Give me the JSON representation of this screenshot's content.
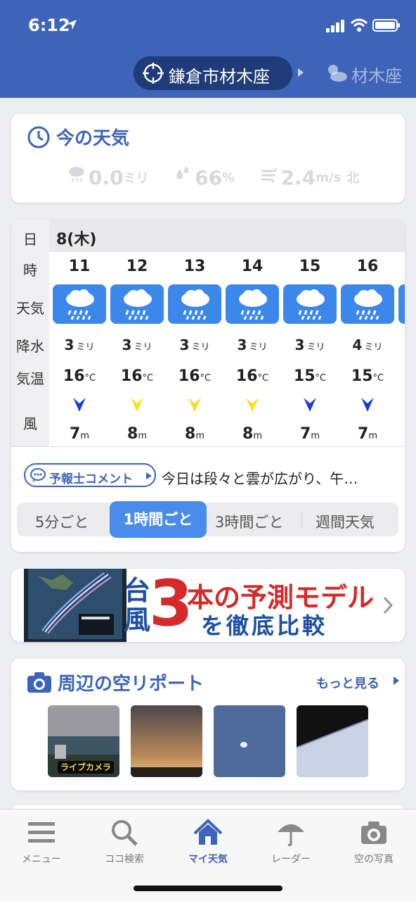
{
  "status_bar": {
    "time": "6:12"
  },
  "header": {
    "current_location": "鎌倉市材木座",
    "other_location": "材木座"
  },
  "now_weather": {
    "title": "今の天気",
    "precip_value": "0.0",
    "precip_unit": "ミリ",
    "humidity_value": "66",
    "humidity_unit": "%",
    "wind_value": "2.4",
    "wind_unit": "m/s",
    "wind_dir": "北"
  },
  "forecast": {
    "labels": {
      "day": "日",
      "hour": "時",
      "weather": "天気",
      "precip": "降水",
      "temp": "気温",
      "wind": "風"
    },
    "date": "8(木)",
    "units": {
      "precip": "ミリ",
      "temp": "°C",
      "wind": "m"
    },
    "hours": [
      {
        "hour": "11",
        "weather_icon": "rain-icon",
        "precip": "3",
        "temp": "16",
        "wind_color": "#1a3fd1",
        "wind": "7"
      },
      {
        "hour": "12",
        "weather_icon": "rain-icon",
        "precip": "3",
        "temp": "16",
        "wind_color": "#f2e128",
        "wind": "8"
      },
      {
        "hour": "13",
        "weather_icon": "rain-icon",
        "precip": "3",
        "temp": "16",
        "wind_color": "#f2e128",
        "wind": "8"
      },
      {
        "hour": "14",
        "weather_icon": "rain-icon",
        "precip": "3",
        "temp": "16",
        "wind_color": "#f2e128",
        "wind": "8"
      },
      {
        "hour": "15",
        "weather_icon": "rain-icon",
        "precip": "3",
        "temp": "15",
        "wind_color": "#1a3fd1",
        "wind": "7"
      },
      {
        "hour": "16",
        "weather_icon": "rain-icon",
        "precip": "4",
        "temp": "15",
        "wind_color": "#1a3fd1",
        "wind": "7"
      }
    ],
    "comment_button": "予報士コメント",
    "comment_text": "今日は段々と雲が広がり、午…",
    "tabs": [
      "5分ごと",
      "1時間ごと",
      "3時間ごと",
      "週間天気"
    ],
    "active_tab": "1時間ごと"
  },
  "banner": {
    "line_a": "台",
    "line_b": "風",
    "number": "3",
    "headline": "本の予測モデル",
    "subline": "を徹底比較"
  },
  "sky_report": {
    "title": "周辺の空リポート",
    "more": "もっと見る",
    "live_badge": "ライブカメラ"
  },
  "tabbar": {
    "items": [
      {
        "label": "メニュー",
        "icon": "menu-icon"
      },
      {
        "label": "ココ検索",
        "icon": "search-icon"
      },
      {
        "label": "マイ天気",
        "icon": "home-icon"
      },
      {
        "label": "レーダー",
        "icon": "umbrella-icon"
      },
      {
        "label": "空の写真",
        "icon": "camera-icon"
      }
    ],
    "active": "マイ天気"
  },
  "colors": {
    "brand": "#3d64b8",
    "weather_tile": "#3c87ea",
    "banner_red": "#d52a2a"
  }
}
